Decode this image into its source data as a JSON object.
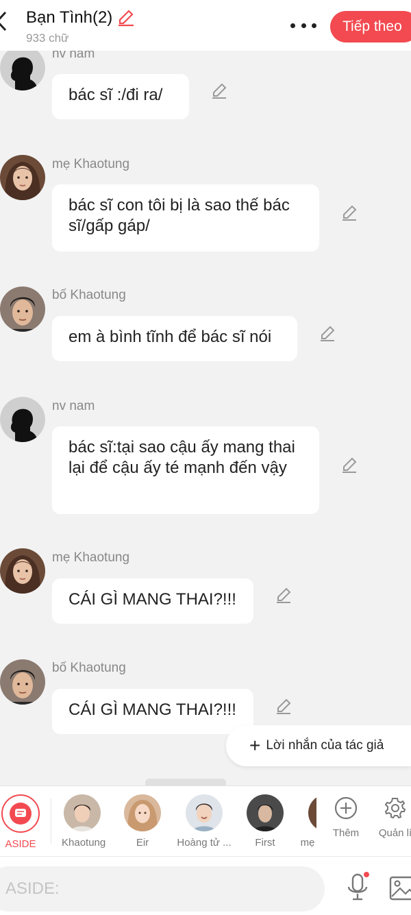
{
  "header": {
    "title": "Bạn Tình(2)",
    "word_count": "933 chữ",
    "next_label": "Tiếp theo"
  },
  "messages": [
    {
      "name": "nv nam",
      "text": "bác sĩ :/đi ra/",
      "avatar": "silhouette"
    },
    {
      "name": "mẹ Khaotung",
      "text": "bác sĩ con tôi bị là sao thế bác sĩ/gấp gáp/",
      "avatar": "woman"
    },
    {
      "name": "bố Khaotung",
      "text": "em à bình tĩnh để bác sĩ nói",
      "avatar": "man"
    },
    {
      "name": "nv nam",
      "text": "bác sĩ:tại sao cậu ấy mang thai lại để cậu ấy té mạnh đến vậy",
      "avatar": "silhouette"
    },
    {
      "name": "mẹ Khaotung",
      "text": "CÁI GÌ MANG THAI?!!!",
      "avatar": "woman"
    },
    {
      "name": "bố Khaotung",
      "text": "CÁI GÌ MANG THAI?!!!",
      "avatar": "man"
    }
  ],
  "author_note": {
    "label": "Lời nhắn của tác giả"
  },
  "characters": [
    {
      "label": "ASIDE"
    },
    {
      "label": "Khaotung"
    },
    {
      "label": "Eir"
    },
    {
      "label": "Hoàng tử ..."
    },
    {
      "label": "First"
    },
    {
      "label": "mẹ"
    }
  ],
  "tools": {
    "add_label": "Thêm",
    "manage_label": "Quản lí"
  },
  "input": {
    "placeholder": "ASIDE:"
  },
  "colors": {
    "accent": "#f24a50",
    "background": "#f2f2f2",
    "bubble": "#ffffff"
  }
}
